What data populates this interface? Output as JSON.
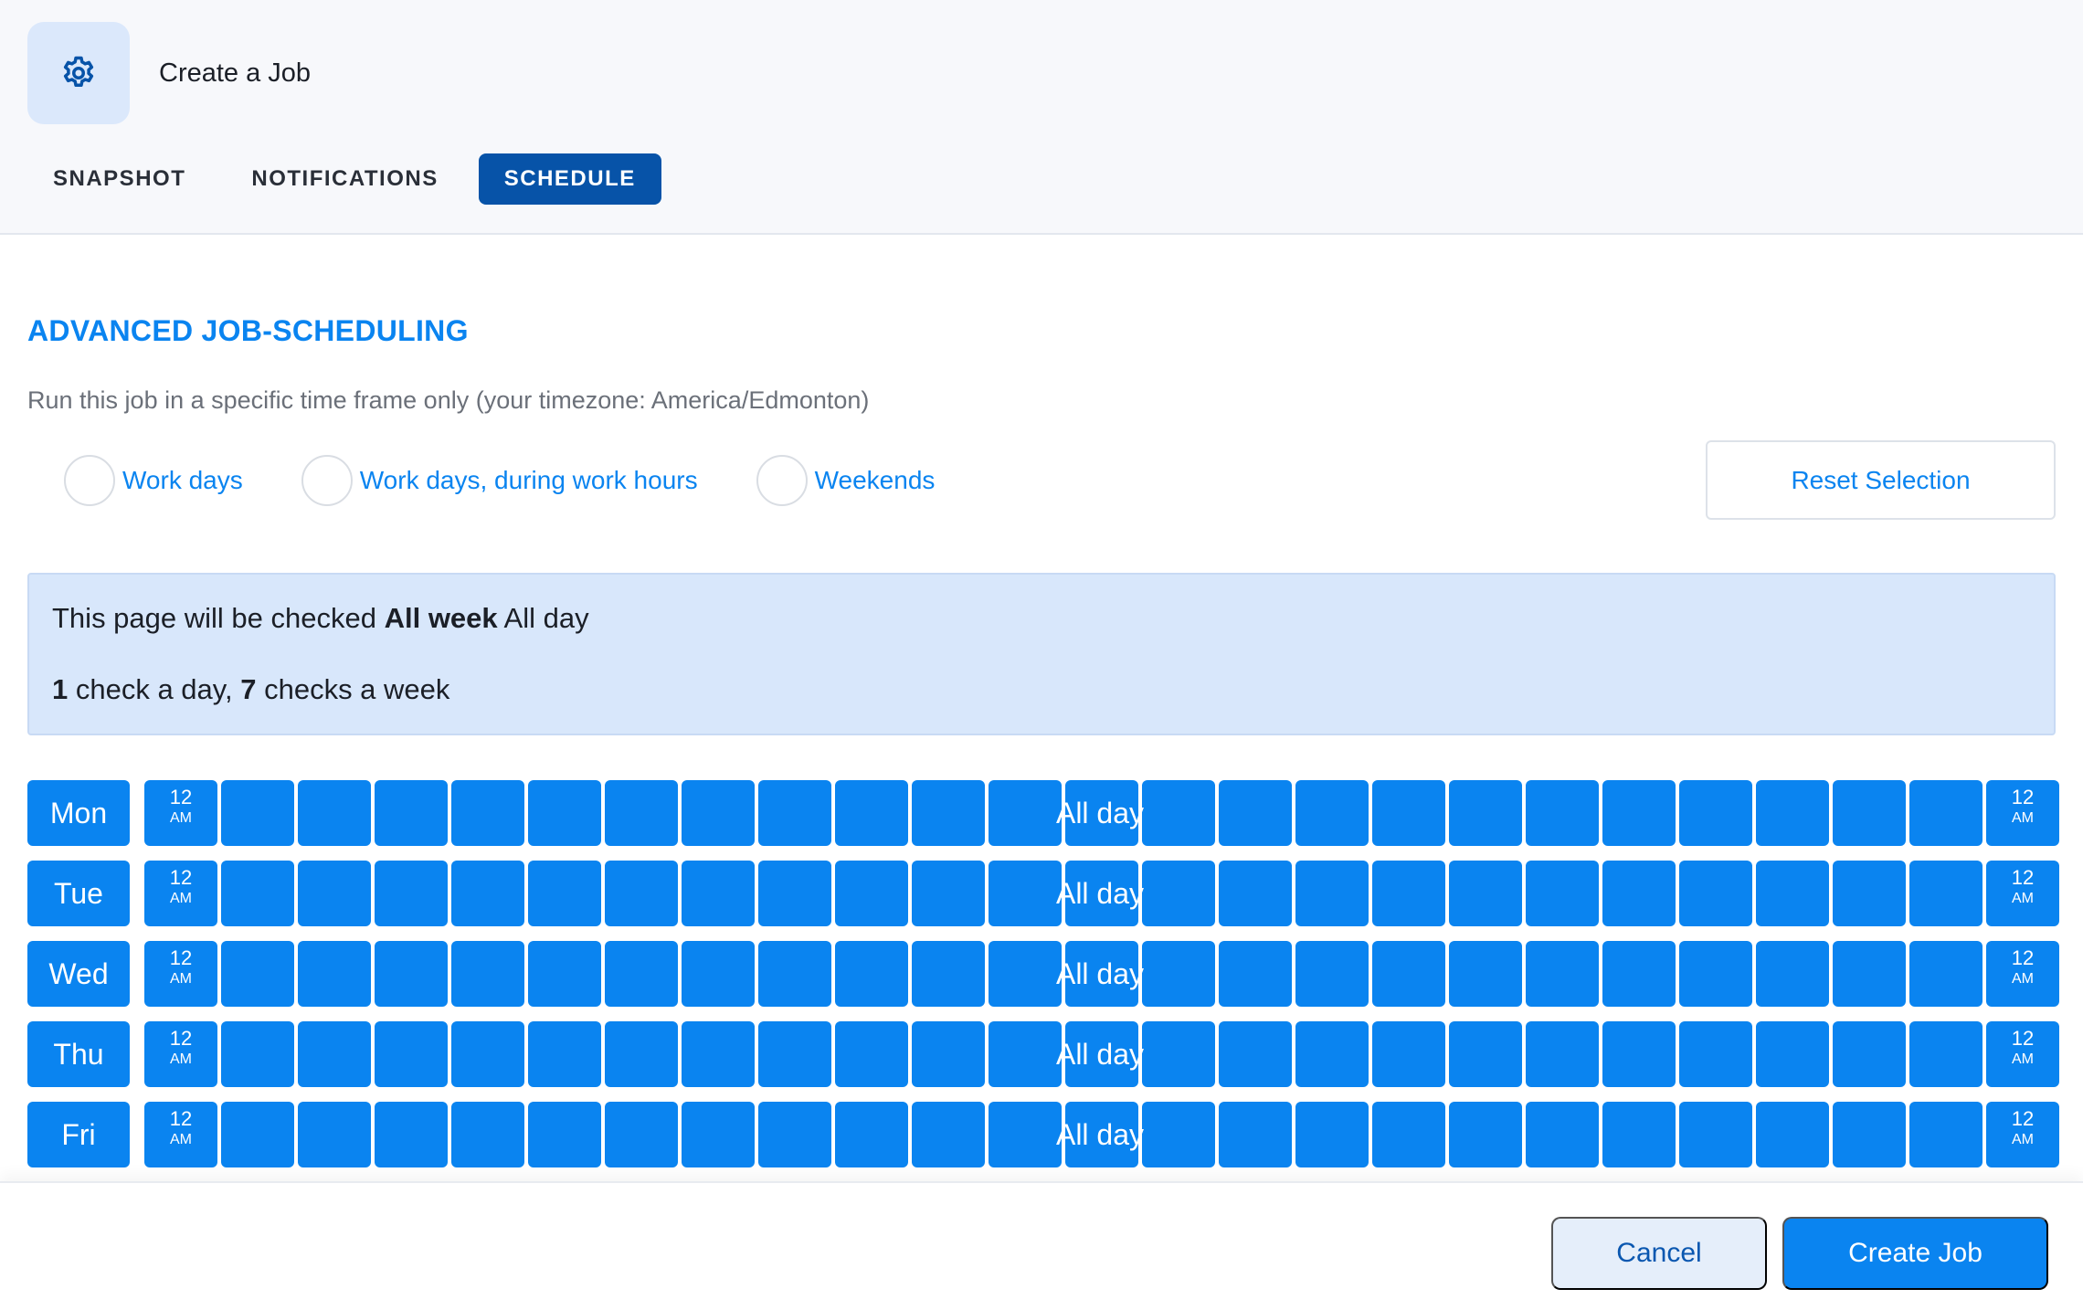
{
  "header": {
    "title": "Create a Job",
    "icon": "gear-icon",
    "tabs": [
      {
        "label": "SNAPSHOT",
        "active": false
      },
      {
        "label": "NOTIFICATIONS",
        "active": false
      },
      {
        "label": "SCHEDULE",
        "active": true
      }
    ]
  },
  "scheduling": {
    "title": "ADVANCED JOB-SCHEDULING",
    "description": "Run this job in a specific time frame only (your timezone: America/Edmonton)",
    "presets": [
      "Work days",
      "Work days, during work hours",
      "Weekends"
    ],
    "reset_label": "Reset Selection"
  },
  "summary": {
    "line1_prefix": "This page will be checked ",
    "line1_bold": "All week",
    "line1_suffix": " All day",
    "checks_per_day": "1",
    "checks_per_day_label": " check a day, ",
    "checks_per_week": "7",
    "checks_per_week_label": " checks a week"
  },
  "schedule": {
    "days": [
      "Mon",
      "Tue",
      "Wed",
      "Thu",
      "Fri"
    ],
    "range_label": "All day",
    "start_time": "12",
    "start_ampm": "AM",
    "end_time": "12",
    "end_ampm": "AM"
  },
  "footer": {
    "cancel_label": "Cancel",
    "create_label": "Create Job"
  },
  "colors": {
    "accent": "#0a84f0",
    "tab_active": "#0753a8",
    "info_bg": "#d8e7fb"
  }
}
